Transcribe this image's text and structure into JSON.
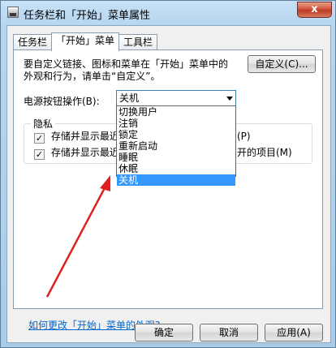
{
  "window": {
    "title": "任务栏和「开始」菜单属性",
    "close_glyph": "x"
  },
  "tabs": [
    {
      "label": "任务栏"
    },
    {
      "label": "「开始」菜单"
    },
    {
      "label": "工具栏"
    }
  ],
  "panel": {
    "description": "要自定义链接、图标和菜单在「开始」菜单中的外观和行为，请单击“自定义”。",
    "customize_button": "自定义(C)...",
    "power_label": "电源按钮操作(B):",
    "power_selected": "关机",
    "power_options": [
      "切换用户",
      "注销",
      "锁定",
      "重新启动",
      "睡眠",
      "休眠",
      "关机"
    ],
    "privacy": {
      "title": "隐私",
      "item1_visible_start": "存储并显示最近",
      "item1_visible_end": "(P)",
      "item2_visible_start": "存储并显示最近",
      "item2_visible_end": "开的项目(M)"
    },
    "help_link": "如何更改「开始」菜单的外观?"
  },
  "footer": {
    "ok": "确定",
    "cancel": "取消",
    "apply": "应用(A)"
  },
  "annotation_arrow_color": "#e02020"
}
